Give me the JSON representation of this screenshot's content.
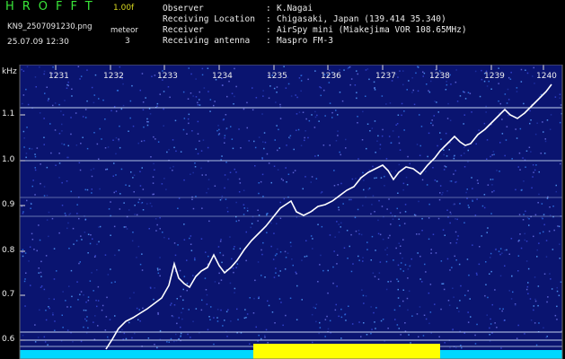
{
  "header": {
    "app_title": "HROFFT",
    "version": "1.00f",
    "file_name": "KN9_2507091230.png",
    "mode_label": "meteor",
    "mode_value": "3",
    "datetime": "25.07.09 12:30",
    "fields": [
      {
        "label": "Observer",
        "value": "K.Nagai"
      },
      {
        "label": "Receiving Location",
        "value": "Chigasaki, Japan (139.414 35.340)"
      },
      {
        "label": "Receiver",
        "value": "AirSpy mini (Miakejima VOR 108.65MHz)"
      },
      {
        "label": "Receiving antenna",
        "value": "Maspro FM-3"
      }
    ]
  },
  "axes": {
    "y_unit": "kHz",
    "x_ticks": [
      "1231",
      "1232",
      "1233",
      "1234",
      "1235",
      "1236",
      "1237",
      "1238",
      "1239",
      "1240"
    ],
    "y_ticks": [
      "1.1",
      "1.0",
      "0.9",
      "0.8",
      "0.7",
      "0.6"
    ]
  },
  "colors": {
    "background": "#000000",
    "waterfall": "#0a1470",
    "reference_line": "#d8e8ff",
    "trace": "#ffffff",
    "bottom_strip": "#00d8ff",
    "bottom_highlight": "#ffff00"
  }
}
